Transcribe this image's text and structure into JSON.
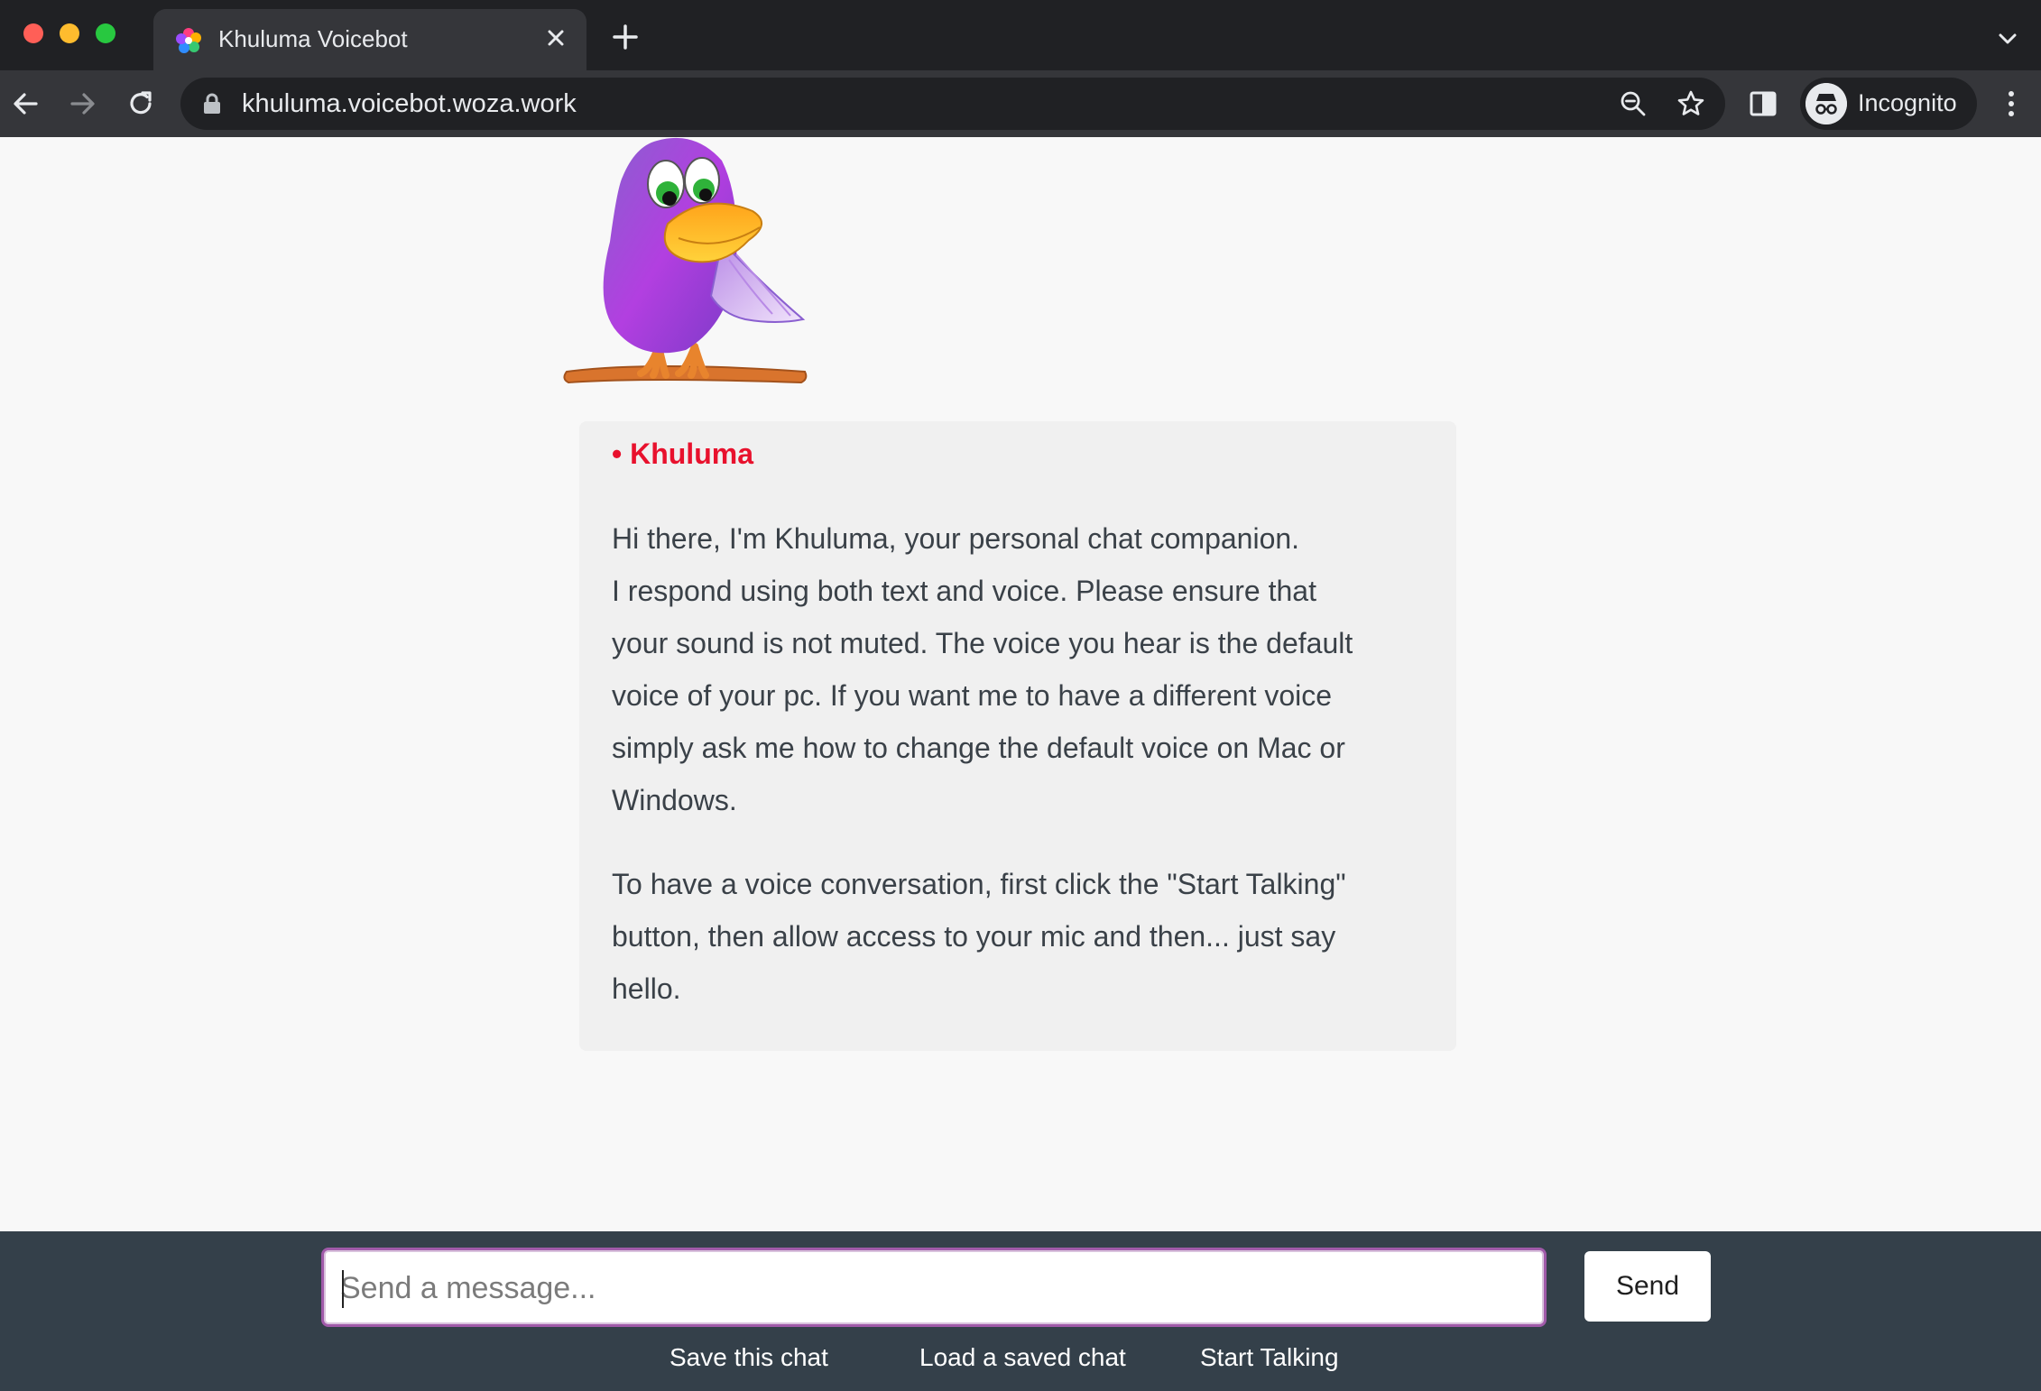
{
  "browser": {
    "tab_title": "Khuluma Voicebot",
    "url": "khuluma.voicebot.woza.work",
    "profile_label": "Incognito"
  },
  "chat": {
    "speaker": "• Khuluma",
    "speaker_color": "#e8112d",
    "paragraph1_lines": [
      "Hi there, I'm Khuluma, your personal chat companion.",
      "I respond using both text and voice. Please ensure that",
      "your sound is not muted. The voice you hear is the default",
      "voice of your pc. If you want me to have a different voice",
      "simply ask me how to change the default voice on Mac or",
      "Windows."
    ],
    "paragraph2_lines": [
      "To have a voice conversation, first click the \"Start Talking\"",
      "button, then allow access to your mic and then... just say",
      "hello."
    ]
  },
  "footer": {
    "input_placeholder": "Send a message...",
    "send_label": "Send",
    "save_label": "Save this chat",
    "load_label": "Load a saved chat",
    "talk_label": "Start Talking"
  },
  "icons": {
    "mascot": "purple-parrot-mascot",
    "favicon": "pinwheel-favicon"
  }
}
